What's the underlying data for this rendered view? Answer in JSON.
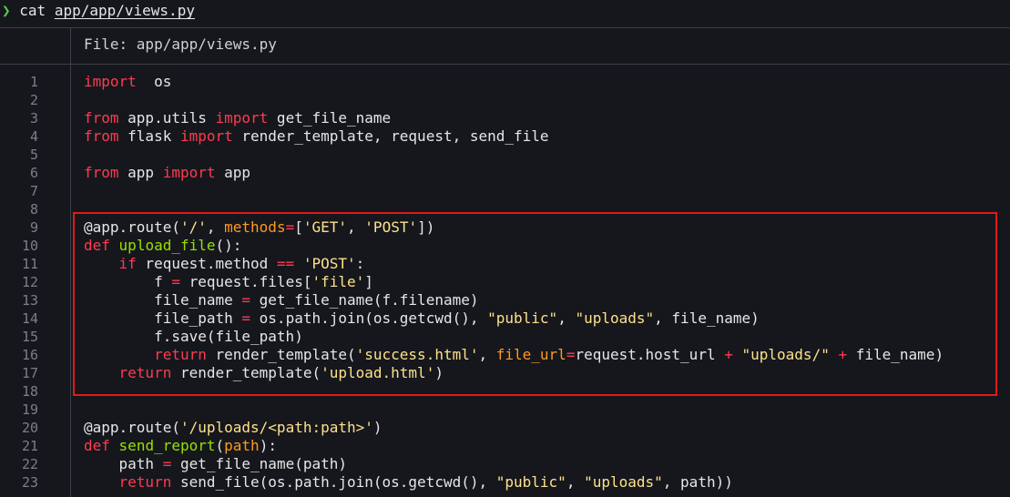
{
  "terminal": {
    "prompt_symbol": "❯",
    "command": "cat",
    "command_path": "app/app/views.py"
  },
  "viewer": {
    "header": "File: app/app/views.py",
    "accent_colors": {
      "keyword": "#ff3b4e",
      "function": "#98e000",
      "string": "#ffe18a",
      "parameter": "#ff9a1f",
      "highlight_box": "#e11a1a"
    },
    "lines": [
      {
        "n": "1",
        "tokens": [
          [
            "kw",
            "import"
          ],
          [
            "",
            "  os"
          ]
        ]
      },
      {
        "n": "2",
        "tokens": []
      },
      {
        "n": "3",
        "tokens": [
          [
            "kw",
            "from"
          ],
          [
            "",
            " app.utils "
          ],
          [
            "kw",
            "import"
          ],
          [
            "",
            " get_file_name"
          ]
        ]
      },
      {
        "n": "4",
        "tokens": [
          [
            "kw",
            "from"
          ],
          [
            "",
            " flask "
          ],
          [
            "kw",
            "import"
          ],
          [
            "",
            " render_template, request, send_file"
          ]
        ]
      },
      {
        "n": "5",
        "tokens": []
      },
      {
        "n": "6",
        "tokens": [
          [
            "kw",
            "from"
          ],
          [
            "",
            " app "
          ],
          [
            "kw",
            "import"
          ],
          [
            "",
            " app"
          ]
        ]
      },
      {
        "n": "7",
        "tokens": []
      },
      {
        "n": "8",
        "tokens": []
      },
      {
        "n": "9",
        "tokens": [
          [
            "",
            "@app.route("
          ],
          [
            "st",
            "'/'"
          ],
          [
            "",
            ", "
          ],
          [
            "pm",
            "methods"
          ],
          [
            "op",
            "="
          ],
          [
            "",
            "["
          ],
          [
            "st",
            "'GET'"
          ],
          [
            "",
            ", "
          ],
          [
            "st",
            "'POST'"
          ],
          [
            "",
            "])"
          ]
        ]
      },
      {
        "n": "10",
        "tokens": [
          [
            "kw",
            "def"
          ],
          [
            "",
            " "
          ],
          [
            "fn",
            "upload_file"
          ],
          [
            "",
            "():"
          ]
        ]
      },
      {
        "n": "11",
        "tokens": [
          [
            "",
            "    "
          ],
          [
            "kw",
            "if"
          ],
          [
            "",
            " request.method "
          ],
          [
            "op",
            "=="
          ],
          [
            "",
            " "
          ],
          [
            "st",
            "'POST'"
          ],
          [
            "",
            ":"
          ]
        ]
      },
      {
        "n": "12",
        "tokens": [
          [
            "",
            "        f "
          ],
          [
            "op",
            "="
          ],
          [
            "",
            " request.files["
          ],
          [
            "st",
            "'file'"
          ],
          [
            "",
            "]"
          ]
        ]
      },
      {
        "n": "13",
        "tokens": [
          [
            "",
            "        file_name "
          ],
          [
            "op",
            "="
          ],
          [
            "",
            " get_file_name(f.filename)"
          ]
        ]
      },
      {
        "n": "14",
        "tokens": [
          [
            "",
            "        file_path "
          ],
          [
            "op",
            "="
          ],
          [
            "",
            " os.path.join(os.getcwd(), "
          ],
          [
            "st",
            "\"public\""
          ],
          [
            "",
            ", "
          ],
          [
            "st",
            "\"uploads\""
          ],
          [
            "",
            ", file_name)"
          ]
        ]
      },
      {
        "n": "15",
        "tokens": [
          [
            "",
            "        f.save(file_path)"
          ]
        ]
      },
      {
        "n": "16",
        "tokens": [
          [
            "",
            "        "
          ],
          [
            "kw",
            "return"
          ],
          [
            "",
            " render_template("
          ],
          [
            "st",
            "'success.html'"
          ],
          [
            "",
            ", "
          ],
          [
            "pm",
            "file_url"
          ],
          [
            "op",
            "="
          ],
          [
            "",
            "request.host_url "
          ],
          [
            "op",
            "+"
          ],
          [
            "",
            " "
          ],
          [
            "st",
            "\"uploads/\""
          ],
          [
            "",
            " "
          ],
          [
            "op",
            "+"
          ],
          [
            "",
            " file_name)"
          ]
        ]
      },
      {
        "n": "17",
        "tokens": [
          [
            "",
            "    "
          ],
          [
            "kw",
            "return"
          ],
          [
            "",
            " render_template("
          ],
          [
            "st",
            "'upload.html'"
          ],
          [
            "",
            ")"
          ]
        ]
      },
      {
        "n": "18",
        "tokens": []
      },
      {
        "n": "19",
        "tokens": []
      },
      {
        "n": "20",
        "tokens": [
          [
            "",
            "@app.route("
          ],
          [
            "st",
            "'/uploads/<path:path>'"
          ],
          [
            "",
            ")"
          ]
        ]
      },
      {
        "n": "21",
        "tokens": [
          [
            "kw",
            "def"
          ],
          [
            "",
            " "
          ],
          [
            "fn",
            "send_report"
          ],
          [
            "",
            "("
          ],
          [
            "pm",
            "path"
          ],
          [
            "",
            "):"
          ]
        ]
      },
      {
        "n": "22",
        "tokens": [
          [
            "",
            "    path "
          ],
          [
            "op",
            "="
          ],
          [
            "",
            " get_file_name(path)"
          ]
        ]
      },
      {
        "n": "23",
        "tokens": [
          [
            "",
            "    "
          ],
          [
            "kw",
            "return"
          ],
          [
            "",
            " send_file(os.path.join(os.getcwd(), "
          ],
          [
            "st",
            "\"public\""
          ],
          [
            "",
            ", "
          ],
          [
            "st",
            "\"uploads\""
          ],
          [
            "",
            ", path))"
          ]
        ]
      }
    ]
  }
}
